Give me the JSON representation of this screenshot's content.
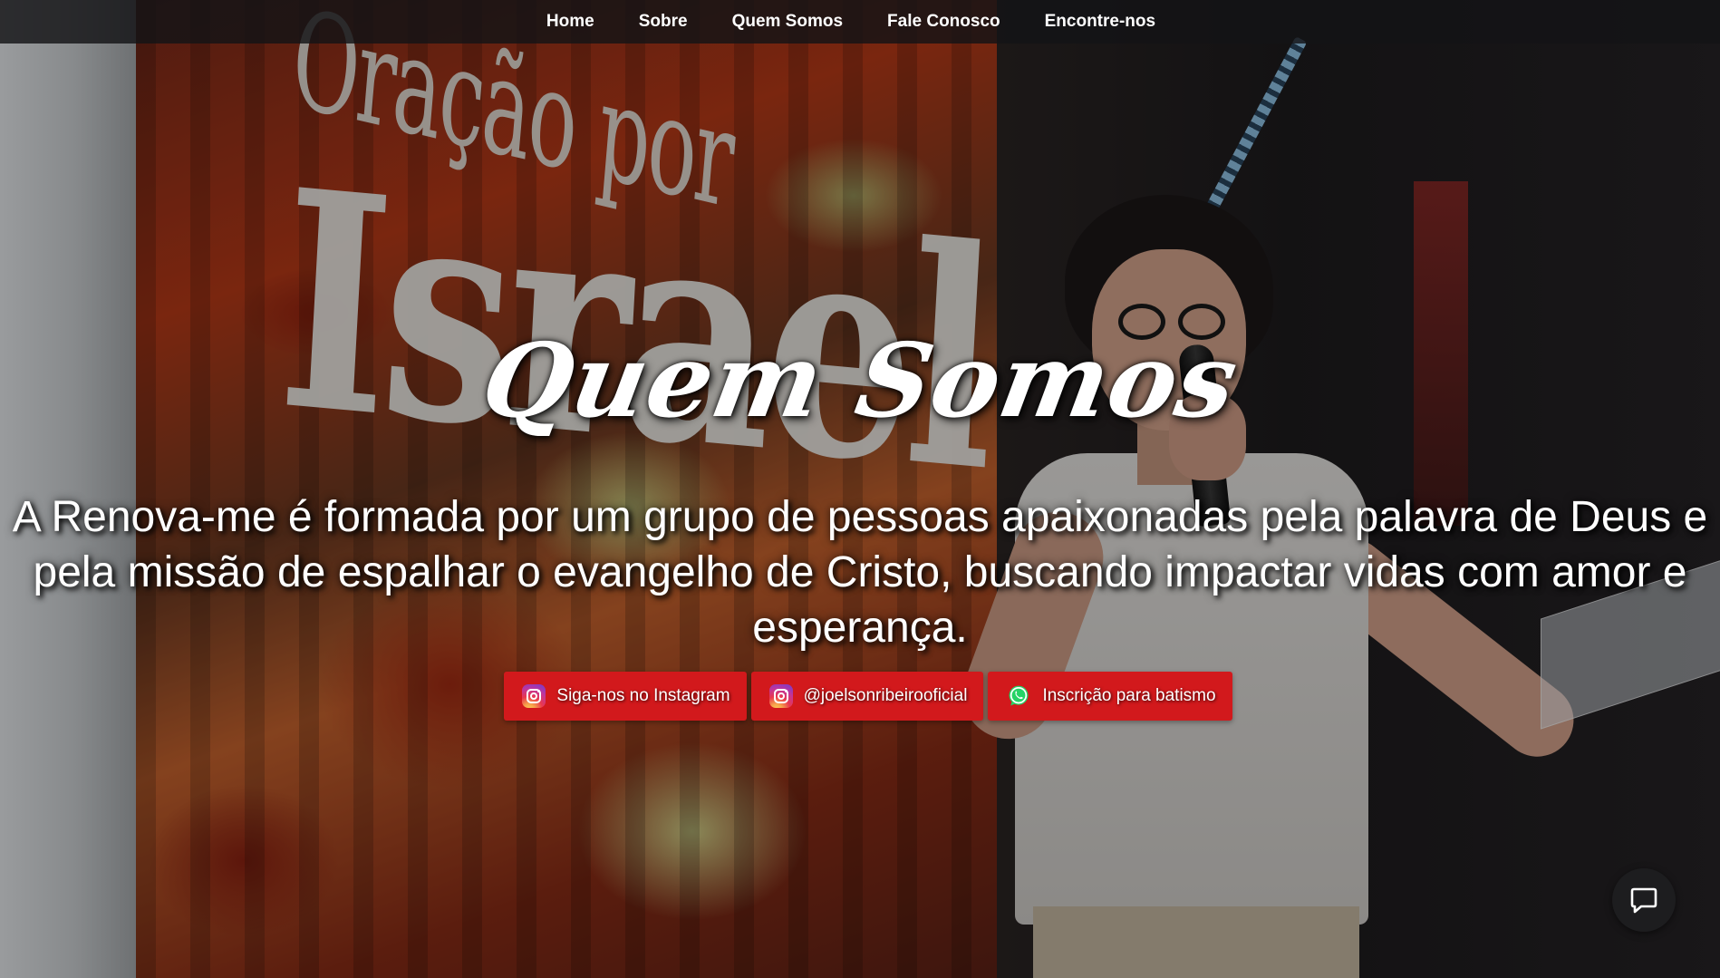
{
  "nav": {
    "items": [
      {
        "label": "Home"
      },
      {
        "label": "Sobre"
      },
      {
        "label": "Quem Somos"
      },
      {
        "label": "Fale Conosco"
      },
      {
        "label": "Encontre-nos"
      }
    ]
  },
  "background": {
    "line1": "Oração por",
    "line2": "Israel"
  },
  "hero": {
    "heading": "Quem Somos",
    "text": "A Renova-me é formada por um grupo de pessoas apaixonadas pela palavra de Deus e pela missão de espalhar o evangelho de Cristo, buscando impactar vidas com amor e esperança."
  },
  "buttons": [
    {
      "label": "Siga-nos no Instagram",
      "icon": "instagram-icon"
    },
    {
      "label": "@joelsonribeirooficial",
      "icon": "instagram-icon"
    },
    {
      "label": "Inscrição para batismo",
      "icon": "whatsapp-icon"
    }
  ],
  "chat": {
    "icon": "chat-icon"
  },
  "colors": {
    "button_bg": "#d2191c",
    "navbar_bg": "#141416",
    "chat_bg": "#1d1d1f"
  }
}
